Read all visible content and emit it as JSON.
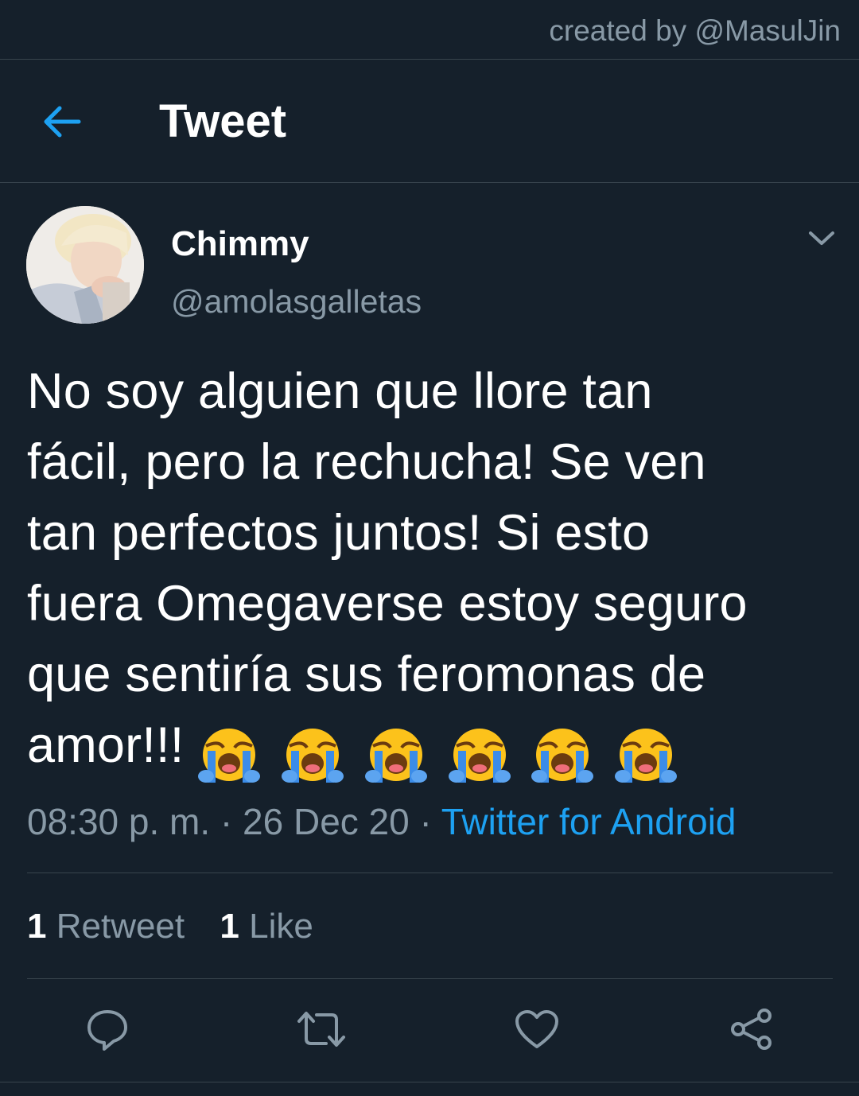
{
  "credit": "created by @MasulJin",
  "header": {
    "title": "Tweet",
    "back_icon": "arrow-left-icon"
  },
  "tweet": {
    "author": {
      "display_name": "Chimmy",
      "handle": "@amolasgalletas"
    },
    "text_lines": [
      "No soy alguien que llore tan",
      "fácil, pero la rechucha! Se ven",
      "tan perfectos juntos! Si esto",
      "fuera Omegaverse estoy seguro",
      "que sentiría sus feromonas de",
      "amor!!!"
    ],
    "emojis": [
      "loudly-crying-face",
      "loudly-crying-face",
      "loudly-crying-face",
      "loudly-crying-face",
      "loudly-crying-face",
      "loudly-crying-face"
    ],
    "time": "08:30 p. m.",
    "separator": "·",
    "date": "26 Dec 20",
    "source": "Twitter for Android"
  },
  "stats": {
    "retweet_count": "1",
    "retweet_label": "Retweet",
    "like_count": "1",
    "like_label": "Like"
  },
  "actions": [
    "reply-icon",
    "retweet-icon",
    "like-icon",
    "share-icon"
  ],
  "colors": {
    "background": "#15202b",
    "accent": "#1da1f2",
    "muted": "#8899a6",
    "divider": "#38444d"
  }
}
